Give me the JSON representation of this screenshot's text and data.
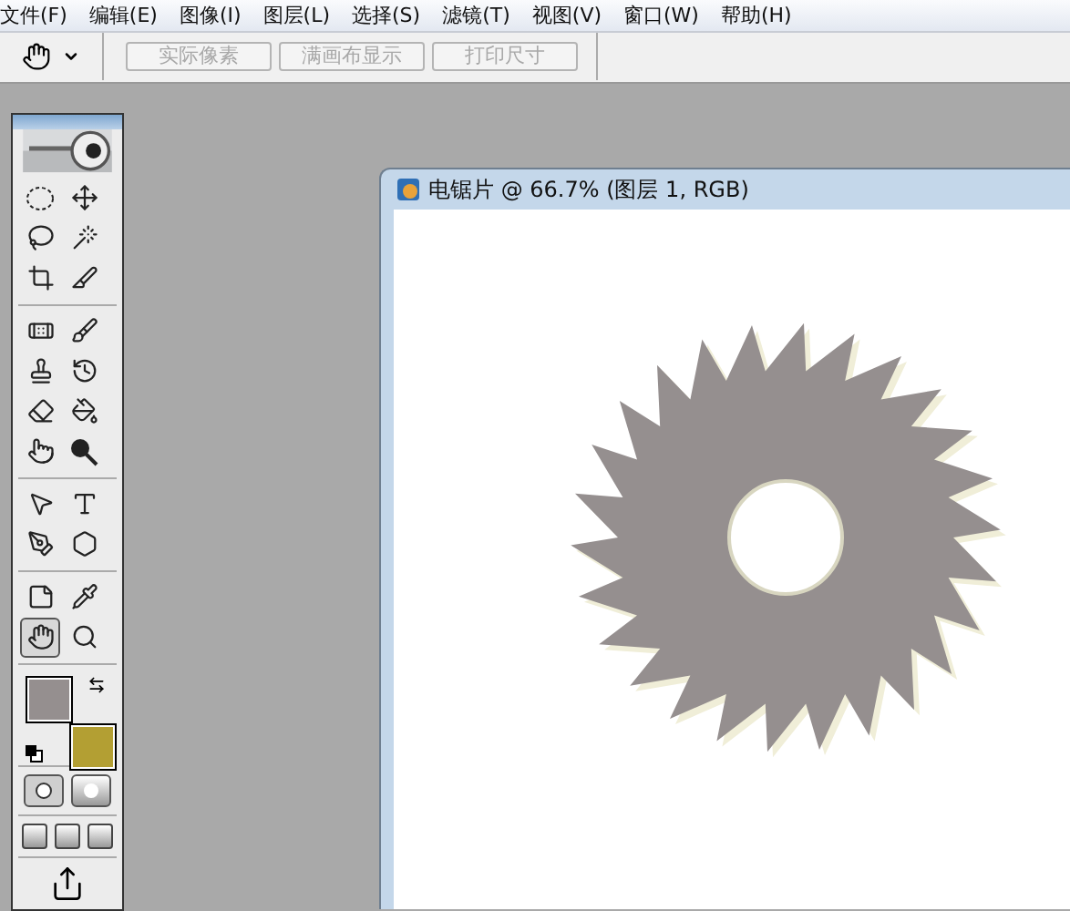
{
  "menu": [
    "文件(F)",
    "编辑(E)",
    "图像(I)",
    "图层(L)",
    "选择(S)",
    "滤镜(T)",
    "视图(V)",
    "窗口(W)",
    "帮助(H)"
  ],
  "options_bar": {
    "buttons": [
      {
        "label": "实际像素",
        "disabled": true
      },
      {
        "label": "满画布显示",
        "disabled": true
      },
      {
        "label": "打印尺寸",
        "disabled": true
      }
    ]
  },
  "toolbox": {
    "groups": [
      [
        {
          "kind": "marquee",
          "selected": false
        },
        {
          "kind": "move",
          "selected": false
        },
        {
          "kind": "lasso",
          "selected": false
        },
        {
          "kind": "wand",
          "selected": false
        },
        {
          "kind": "crop",
          "selected": false
        },
        {
          "kind": "slice",
          "selected": false
        }
      ],
      [
        {
          "kind": "healing",
          "selected": false
        },
        {
          "kind": "brush",
          "selected": false
        },
        {
          "kind": "stamp",
          "selected": false
        },
        {
          "kind": "history",
          "selected": false
        },
        {
          "kind": "eraser",
          "selected": false
        },
        {
          "kind": "bucket",
          "selected": false
        },
        {
          "kind": "smudge",
          "selected": false
        },
        {
          "kind": "dodge",
          "selected": false
        }
      ],
      [
        {
          "kind": "path",
          "selected": false
        },
        {
          "kind": "type",
          "selected": false
        },
        {
          "kind": "pen",
          "selected": false
        },
        {
          "kind": "shape",
          "selected": false
        }
      ],
      [
        {
          "kind": "notes",
          "selected": false
        },
        {
          "kind": "eyedropper",
          "selected": false
        },
        {
          "kind": "hand",
          "selected": true
        },
        {
          "kind": "zoom",
          "selected": false
        }
      ]
    ],
    "foreground": {
      "color": "#958f8f"
    },
    "background": {
      "color": "#b39f33"
    },
    "quick_mask": false
  },
  "document": {
    "title": "电锯片 @ 66.7% (图层 1, RGB)"
  }
}
